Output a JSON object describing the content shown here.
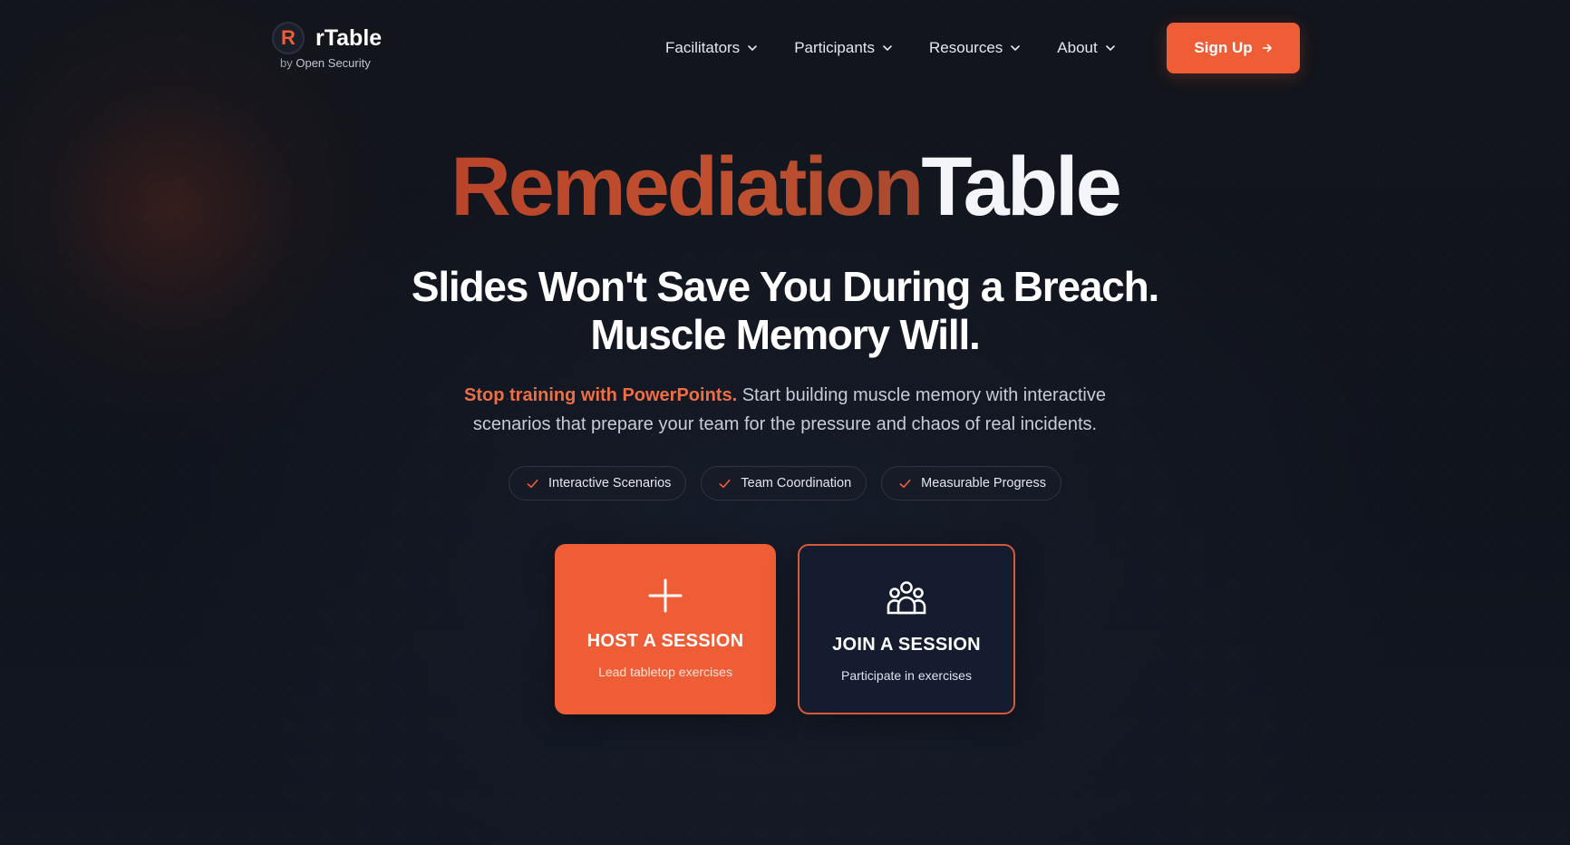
{
  "brand": {
    "logo_letter": "R",
    "name": "rTable",
    "sub_prefix": "by",
    "sub_org": "Open Security",
    "accent": "#ee5d35"
  },
  "nav": {
    "items": [
      {
        "label": "Facilitators",
        "icon": "chevron-down-icon"
      },
      {
        "label": "Participants",
        "icon": "chevron-down-icon"
      },
      {
        "label": "Resources",
        "icon": "chevron-down-icon"
      },
      {
        "label": "About",
        "icon": "chevron-down-icon"
      }
    ],
    "signup_label": "Sign Up",
    "signup_icon": "arrow-right-icon"
  },
  "hero": {
    "title_part1": "Remediation",
    "title_part2": "Table",
    "headline_line1": "Slides Won't Save You During a Breach.",
    "headline_line2": "Muscle Memory Will.",
    "desc_highlight": "Stop training with PowerPoints.",
    "desc_line1_rest": " Start building muscle memory with interactive",
    "desc_line2": "scenarios that prepare your team for the pressure and chaos of real incidents."
  },
  "features": [
    {
      "label": "Interactive Scenarios",
      "icon": "check-icon"
    },
    {
      "label": "Team Coordination",
      "icon": "check-icon"
    },
    {
      "label": "Measurable Progress",
      "icon": "check-icon"
    }
  ],
  "actions": {
    "host": {
      "title": "HOST A SESSION",
      "subtitle": "Lead tabletop exercises",
      "icon": "plus-icon"
    },
    "join": {
      "title": "JOIN A SESSION",
      "subtitle": "Participate in exercises",
      "icon": "users-icon"
    }
  }
}
